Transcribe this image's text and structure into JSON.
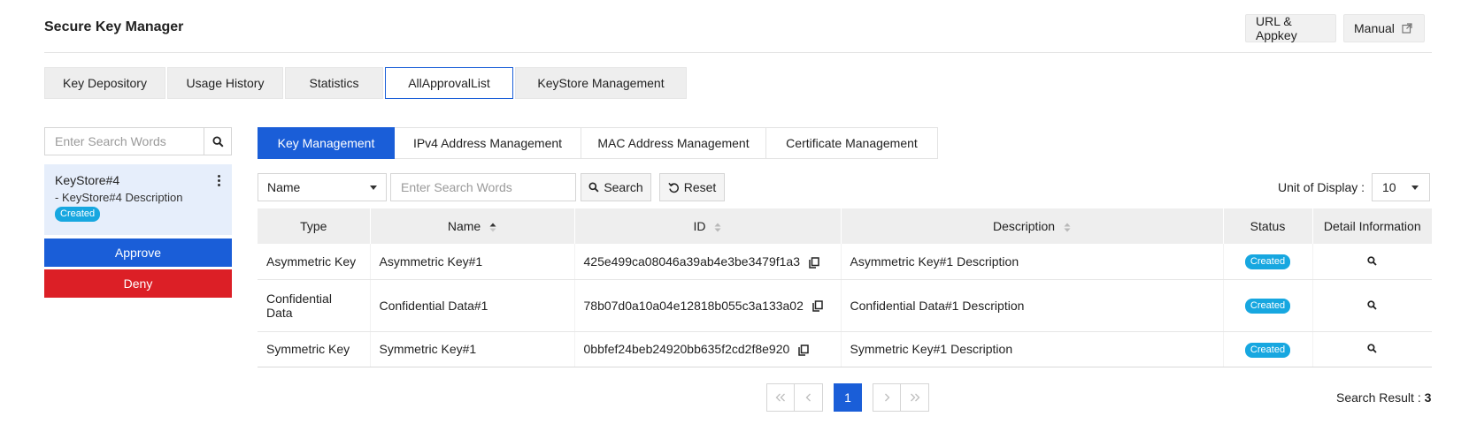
{
  "header": {
    "title": "Secure Key Manager",
    "url_appkey_label": "URL & Appkey",
    "manual_label": "Manual"
  },
  "main_tabs": [
    {
      "label": "Key Depository",
      "active": false
    },
    {
      "label": "Usage History",
      "active": false
    },
    {
      "label": "Statistics",
      "active": false
    },
    {
      "label": "AllApprovalList",
      "active": true
    },
    {
      "label": "KeyStore Management",
      "active": false
    }
  ],
  "sidebar": {
    "search_placeholder": "Enter Search Words",
    "keystore": {
      "name": "KeyStore#4",
      "description": "- KeyStore#4 Description",
      "status": "Created"
    },
    "approve_label": "Approve",
    "deny_label": "Deny"
  },
  "sub_tabs": [
    {
      "label": "Key Management",
      "active": true
    },
    {
      "label": "IPv4 Address Management",
      "active": false
    },
    {
      "label": "MAC Address Management",
      "active": false
    },
    {
      "label": "Certificate Management",
      "active": false
    }
  ],
  "filter": {
    "field_selected": "Name",
    "search_placeholder": "Enter Search Words",
    "search_label": "Search",
    "reset_label": "Reset",
    "unit_label": "Unit of Display :",
    "unit_value": "10"
  },
  "table": {
    "columns": [
      "Type",
      "Name",
      "ID",
      "Description",
      "Status",
      "Detail Information"
    ],
    "rows": [
      {
        "type": "Asymmetric Key",
        "name": "Asymmetric Key#1",
        "id": "425e499ca08046a39ab4e3be3479f1a3",
        "description": "Asymmetric Key#1 Description",
        "status": "Created"
      },
      {
        "type": "Confidential Data",
        "name": "Confidential Data#1",
        "id": "78b07d0a10a04e12818b055c3a133a02",
        "description": "Confidential Data#1 Description",
        "status": "Created"
      },
      {
        "type": "Symmetric Key",
        "name": "Symmetric Key#1",
        "id": "0bbfef24beb24920bb635f2cd2f8e920",
        "description": "Symmetric Key#1 Description",
        "status": "Created"
      }
    ]
  },
  "pagination": {
    "current_page": "1",
    "result_label": "Search Result :",
    "result_count": "3"
  },
  "colors": {
    "accent": "#1a5ed8",
    "deny": "#dc1f26",
    "badge": "#17a7e0"
  },
  "icons": {
    "external": "external-link-icon",
    "search": "search-icon",
    "kebab": "kebab-menu-icon",
    "copy": "copy-icon",
    "sort": "sort-icon",
    "reset": "reset-icon",
    "caret": "chevron-down-icon"
  }
}
